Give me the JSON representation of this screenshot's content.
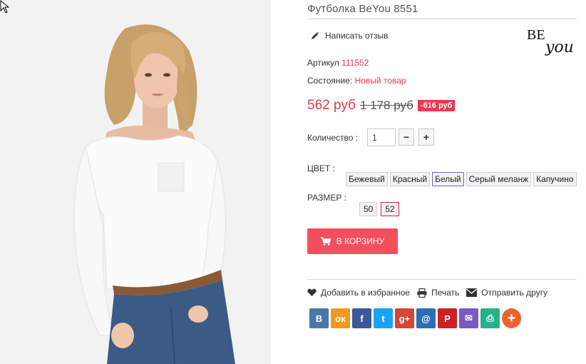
{
  "product": {
    "title": "Футболка BeYou 8551",
    "review_link": "Написать отзыв",
    "sku_label": "Артикул",
    "sku_value": "111552",
    "condition_label": "Состояние:",
    "condition_value": "Новый товар",
    "price_new": "562 руб",
    "price_old": "1 178 руб",
    "discount": "-616 руб",
    "brand_logo_text": "BE you"
  },
  "quantity": {
    "label": "Количество :",
    "value": "1",
    "minus": "−",
    "plus": "+"
  },
  "color": {
    "label": "ЦВЕТ :",
    "options": [
      "Бежевый",
      "Красный",
      "Белый",
      "Серый меланж",
      "Капучино"
    ],
    "selected": "Белый"
  },
  "size": {
    "label": "РАЗМЕР :",
    "options": [
      "50",
      "52"
    ],
    "selected": "52"
  },
  "cart": {
    "label": "В КОРЗИНУ"
  },
  "actions": {
    "wishlist": "Добавить в избранное",
    "print": "Печать",
    "send": "Отправить другу"
  },
  "social": [
    {
      "icon": "vk-icon",
      "glyph": "В",
      "color": "#4a76a8"
    },
    {
      "icon": "odnoklassniki-icon",
      "glyph": "ок",
      "color": "#f39a1e"
    },
    {
      "icon": "facebook-icon",
      "glyph": "f",
      "color": "#3b5998"
    },
    {
      "icon": "twitter-icon",
      "glyph": "t",
      "color": "#1da1f2"
    },
    {
      "icon": "google-plus-icon",
      "glyph": "g+",
      "color": "#d34836"
    },
    {
      "icon": "mail-ru-icon",
      "glyph": "@",
      "color": "#2d6db5"
    },
    {
      "icon": "pinterest-icon",
      "glyph": "P",
      "color": "#cb2027"
    },
    {
      "icon": "email-icon",
      "glyph": "✉",
      "color": "#7b58c2"
    },
    {
      "icon": "print-icon",
      "glyph": "⎙",
      "color": "#28b08d"
    },
    {
      "icon": "more-icon",
      "glyph": "+",
      "color": "#f0612f"
    }
  ],
  "colors": {
    "accent": "#e83a50",
    "cart_button": "#f2505f"
  }
}
